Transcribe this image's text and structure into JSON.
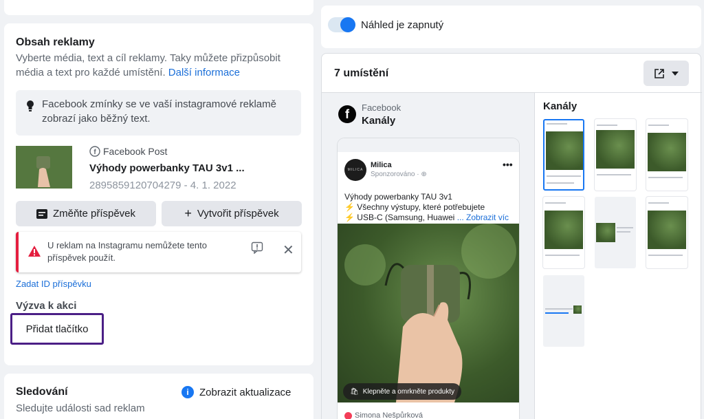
{
  "left": {
    "ad_content": {
      "title": "Obsah reklamy",
      "description": "Vyberte média, text a cíl reklamy. Taky můžete přizpůsobit média a text pro každé umístění.",
      "learn_more": "Další informace",
      "info_box": "Facebook zmínky se ve vaší instagramové reklamě zobrazí jako běžný text.",
      "post": {
        "source": "Facebook Post",
        "title": "Výhody powerbanky TAU 3v1 ...",
        "id_date": "2895859120704279 - 4. 1. 2022"
      },
      "change_post_btn": "Změňte příspěvek",
      "create_post_btn": "Vytvořit příspěvek",
      "alert": "U reklam na Instagramu nemůžete tento příspěvek použít.",
      "enter_post_id": "Zadat ID příspěvku",
      "cta_label": "Výzva k akci",
      "add_button": "Přidat tlačítko"
    },
    "tracking": {
      "title": "Sledování",
      "description": "Sledujte události sad reklam",
      "show_updates": "Zobrazit aktualizace"
    }
  },
  "right": {
    "preview_toggle": "Náhled je zapnutý",
    "placements_title": "7 umístění",
    "platform": "Facebook",
    "placement": "Kanály",
    "channels_title": "Kanály",
    "post_preview": {
      "page_name": "Milica",
      "avatar_text": "MILICA",
      "sponsored": "Sponzorováno · ",
      "line1": "Výhody powerbanky TAU 3v1",
      "line2": "Všechny výstupy, které potřebujete",
      "line3": "USB-C (Samsung, Huawei",
      "see_more": "... Zobrazit víc",
      "shop_pill": "Klepněte a omrkněte produkty",
      "liker": "Simona Nešpůrková"
    }
  },
  "colors": {
    "accent": "#1877f2",
    "link": "#1a6ed8",
    "alert": "#e41e3f",
    "highlight_border": "#4b1f86"
  }
}
